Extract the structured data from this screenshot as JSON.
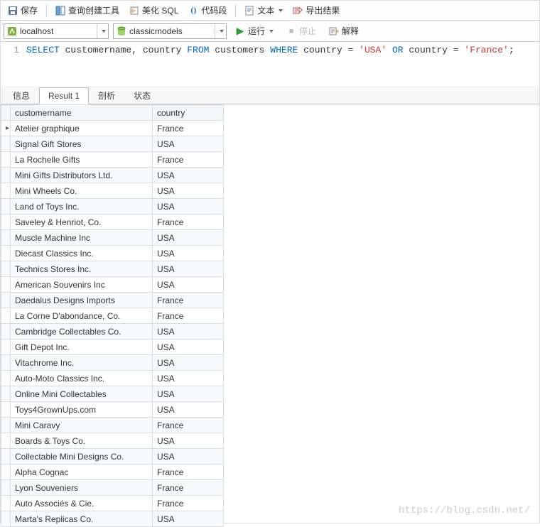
{
  "toolbar": {
    "save": "保存",
    "query_builder": "查询创建工具",
    "beautify": "美化 SQL",
    "snippet": "代码段",
    "text": "文本",
    "export": "导出结果"
  },
  "conn": {
    "host": "localhost",
    "database": "classicmodels",
    "run": "运行",
    "stop": "停止",
    "explain": "解释"
  },
  "editor": {
    "line_no": "1",
    "kw_select": "SELECT",
    "cols": " customername, country ",
    "kw_from": "FROM",
    "tbl": " customers ",
    "kw_where": "WHERE",
    "cond1": " country = ",
    "str1": "'USA'",
    "kw_or": " OR ",
    "cond2": "country = ",
    "str2": "'France'",
    "semi": ";"
  },
  "tabs": {
    "info": "信息",
    "result": "Result 1",
    "profile": "剖析",
    "status": "状态"
  },
  "columns": [
    "customername",
    "country"
  ],
  "rows": [
    {
      "n": "Atelier graphique",
      "c": "France"
    },
    {
      "n": "Signal Gift Stores",
      "c": "USA"
    },
    {
      "n": "La Rochelle Gifts",
      "c": "France"
    },
    {
      "n": "Mini Gifts Distributors Ltd.",
      "c": "USA"
    },
    {
      "n": "Mini Wheels Co.",
      "c": "USA"
    },
    {
      "n": "Land of Toys Inc.",
      "c": "USA"
    },
    {
      "n": "Saveley & Henriot, Co.",
      "c": "France"
    },
    {
      "n": "Muscle Machine Inc",
      "c": "USA"
    },
    {
      "n": "Diecast Classics Inc.",
      "c": "USA"
    },
    {
      "n": "Technics Stores Inc.",
      "c": "USA"
    },
    {
      "n": "American Souvenirs Inc",
      "c": "USA"
    },
    {
      "n": "Daedalus Designs Imports",
      "c": "France"
    },
    {
      "n": "La Corne D'abondance, Co.",
      "c": "France"
    },
    {
      "n": "Cambridge Collectables Co.",
      "c": "USA"
    },
    {
      "n": "Gift Depot Inc.",
      "c": "USA"
    },
    {
      "n": "Vitachrome Inc.",
      "c": "USA"
    },
    {
      "n": "Auto-Moto Classics Inc.",
      "c": "USA"
    },
    {
      "n": "Online Mini Collectables",
      "c": "USA"
    },
    {
      "n": "Toys4GrownUps.com",
      "c": "USA"
    },
    {
      "n": "Mini Caravy",
      "c": "France"
    },
    {
      "n": "Boards & Toys Co.",
      "c": "USA"
    },
    {
      "n": "Collectable Mini Designs Co.",
      "c": "USA"
    },
    {
      "n": "Alpha Cognac",
      "c": "France"
    },
    {
      "n": "Lyon Souveniers",
      "c": "France"
    },
    {
      "n": "Auto Associés & Cie.",
      "c": "France"
    },
    {
      "n": "Marta's Replicas Co.",
      "c": "USA"
    }
  ],
  "watermark": "https://blog.csdn.net/"
}
